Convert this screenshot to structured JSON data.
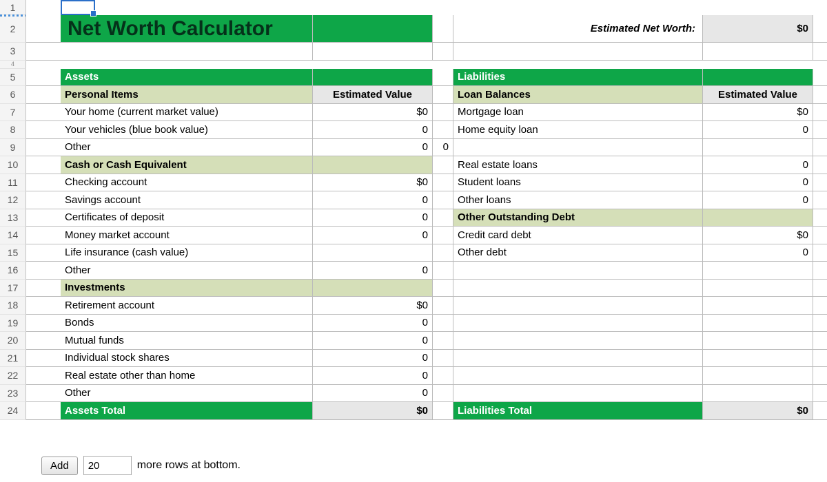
{
  "rowNumbers": [
    "1",
    "2",
    "3",
    "4",
    "5",
    "6",
    "7",
    "8",
    "9",
    "10",
    "11",
    "12",
    "13",
    "14",
    "15",
    "16",
    "17",
    "18",
    "19",
    "20",
    "21",
    "22",
    "23",
    "24"
  ],
  "title": "Net Worth Calculator",
  "estimatedLabel": "Estimated Net Worth:",
  "estimatedValue": "$0",
  "assets": {
    "header": "Assets",
    "colValue": "Estimated Value",
    "personal": {
      "header": "Personal Items",
      "items": [
        {
          "l": "Your home (current market value)",
          "v": "$0"
        },
        {
          "l": "Your vehicles (blue book value)",
          "v": "0"
        },
        {
          "l": "Other",
          "v": "0"
        }
      ]
    },
    "cash": {
      "header": "Cash or Cash Equivalent",
      "items": [
        {
          "l": "Checking account",
          "v": "$0"
        },
        {
          "l": "Savings account",
          "v": "0"
        },
        {
          "l": "Certificates of deposit",
          "v": "0"
        },
        {
          "l": "Money market account",
          "v": "0"
        },
        {
          "l": "Life insurance (cash value)",
          "v": ""
        },
        {
          "l": "Other",
          "v": "0"
        }
      ]
    },
    "investments": {
      "header": "Investments",
      "items": [
        {
          "l": "Retirement account",
          "v": "$0"
        },
        {
          "l": "Bonds",
          "v": "0"
        },
        {
          "l": "Mutual funds",
          "v": "0"
        },
        {
          "l": "Individual stock shares",
          "v": "0"
        },
        {
          "l": "Real estate other than home",
          "v": "0"
        },
        {
          "l": "Other",
          "v": "0"
        }
      ]
    },
    "totalLabel": "Assets Total",
    "totalValue": "$0"
  },
  "liabilities": {
    "header": "Liabilities",
    "colValue": "Estimated Value",
    "loans": {
      "header": "Loan Balances",
      "items": [
        {
          "l": "Mortgage loan",
          "v": "$0"
        },
        {
          "l": "Home equity loan",
          "v": "0"
        },
        {
          "l": "",
          "v": ""
        },
        {
          "l": "Real estate loans",
          "v": "0"
        },
        {
          "l": "Student loans",
          "v": "0"
        },
        {
          "l": "Other loans",
          "v": "0"
        }
      ]
    },
    "other": {
      "header": "Other Outstanding Debt",
      "items": [
        {
          "l": "Credit card debt",
          "v": "$0"
        },
        {
          "l": "Other debt",
          "v": "0"
        }
      ],
      "blanks": 8
    },
    "totalLabel": "Liabilities Total",
    "totalValue": "$0"
  },
  "gapValue": "0",
  "footer": {
    "button": "Add",
    "input": "20",
    "text": "more rows at bottom."
  }
}
